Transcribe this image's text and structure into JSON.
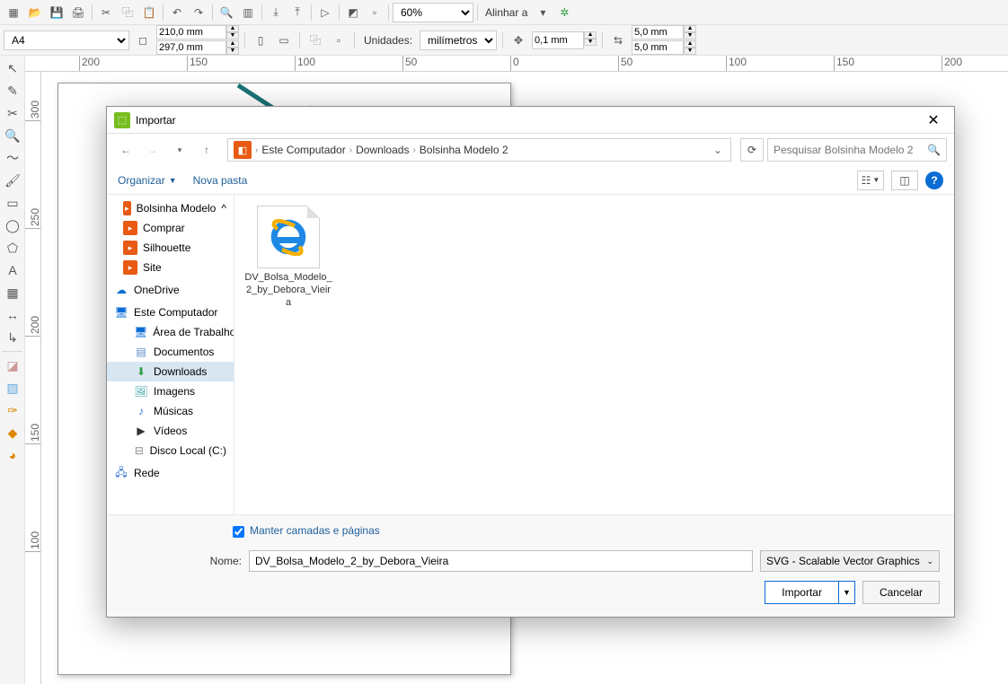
{
  "toolbar": {
    "zoom": "60%",
    "align_label": "Alinhar a",
    "page_size": "A4",
    "width": "210,0 mm",
    "height": "297,0 mm",
    "units_label": "Unidades:",
    "units_value": "milímetros",
    "nudge": "0,1 mm",
    "dup_x": "5,0 mm",
    "dup_y": "5,0 mm"
  },
  "ruler_top": [
    "200",
    "150",
    "100",
    "50",
    "0",
    "50",
    "100",
    "150",
    "200"
  ],
  "ruler_left": [
    "300",
    "250",
    "200",
    "150",
    "100"
  ],
  "dialog": {
    "title": "Importar",
    "path": [
      "Este Computador",
      "Downloads",
      "Bolsinha Modelo 2"
    ],
    "search_placeholder": "Pesquisar Bolsinha Modelo 2",
    "organize": "Organizar",
    "newfolder": "Nova pasta",
    "tree": {
      "favorites": [
        {
          "label": "Bolsinha Modelo",
          "icon": "orange"
        },
        {
          "label": "Comprar",
          "icon": "orange"
        },
        {
          "label": "Silhouette",
          "icon": "orange"
        },
        {
          "label": "Site",
          "icon": "orange"
        }
      ],
      "onedrive": "OneDrive",
      "thispc": "Este Computador",
      "pc_children": [
        {
          "label": "Área de Trabalho",
          "icon": "pc"
        },
        {
          "label": "Documentos",
          "icon": "doc"
        },
        {
          "label": "Downloads",
          "icon": "down",
          "selected": true
        },
        {
          "label": "Imagens",
          "icon": "img"
        },
        {
          "label": "Músicas",
          "icon": "music"
        },
        {
          "label": "Vídeos",
          "icon": "video"
        },
        {
          "label": "Disco Local (C:)",
          "icon": "disk"
        }
      ],
      "network": "Rede"
    },
    "file": {
      "name_lines": "DV_Bolsa_Modelo_2_by_Debora_Vieira"
    },
    "keep_layers": "Manter camadas e páginas",
    "name_label": "Nome:",
    "name_value": "DV_Bolsa_Modelo_2_by_Debora_Vieira",
    "type_value": "SVG - Scalable Vector Graphics",
    "import_btn": "Importar",
    "cancel_btn": "Cancelar"
  }
}
